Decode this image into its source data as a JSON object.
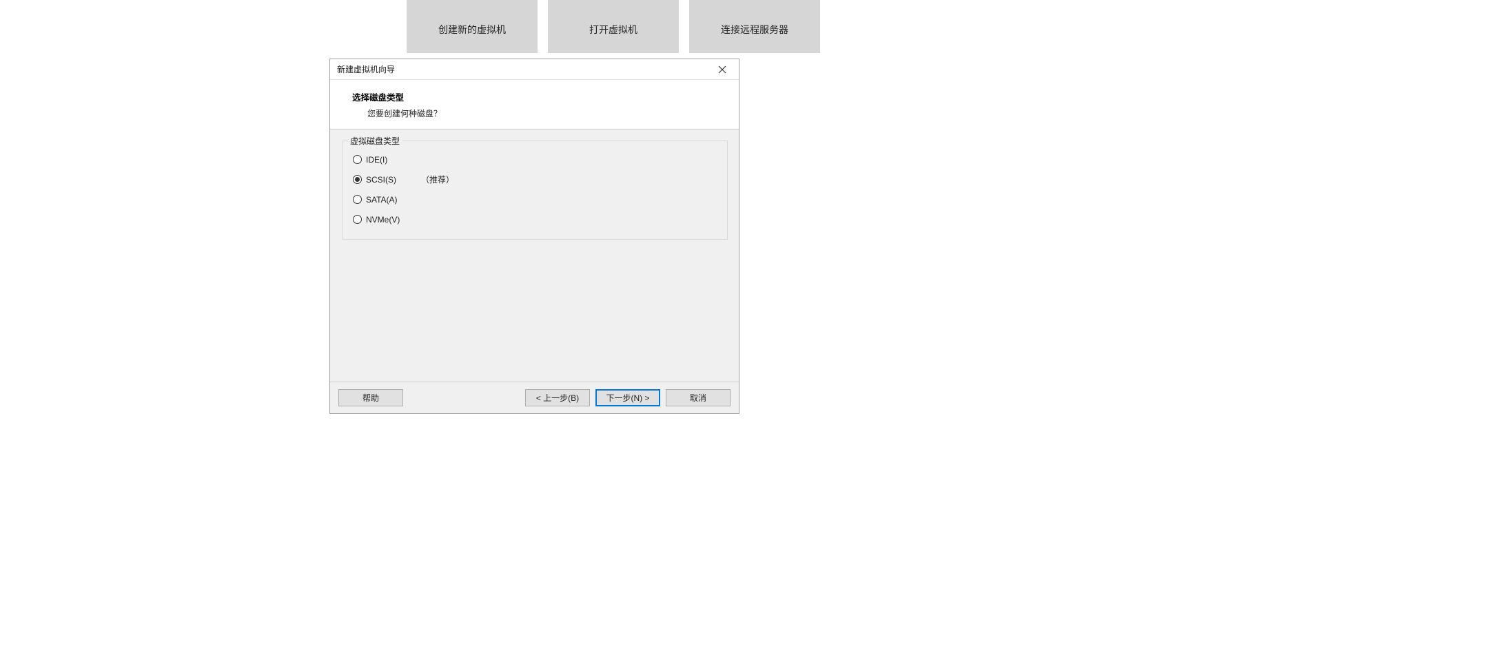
{
  "tiles": {
    "create": "创建新的虚拟机",
    "open": "打开虚拟机",
    "connect": "连接远程服务器"
  },
  "dialog": {
    "title": "新建虚拟机向导",
    "header": {
      "title": "选择磁盘类型",
      "subtitle": "您要创建何种磁盘？"
    },
    "group_legend": "虚拟磁盘类型",
    "options": {
      "ide": "IDE(I)",
      "scsi": "SCSI(S)",
      "sata": "SATA(A)",
      "nvme": "NVMe(V)"
    },
    "recommended": "（推荐）",
    "selected": "scsi",
    "buttons": {
      "help": "帮助",
      "back": "< 上一步(B)",
      "next": "下一步(N) >",
      "cancel": "取消"
    }
  }
}
